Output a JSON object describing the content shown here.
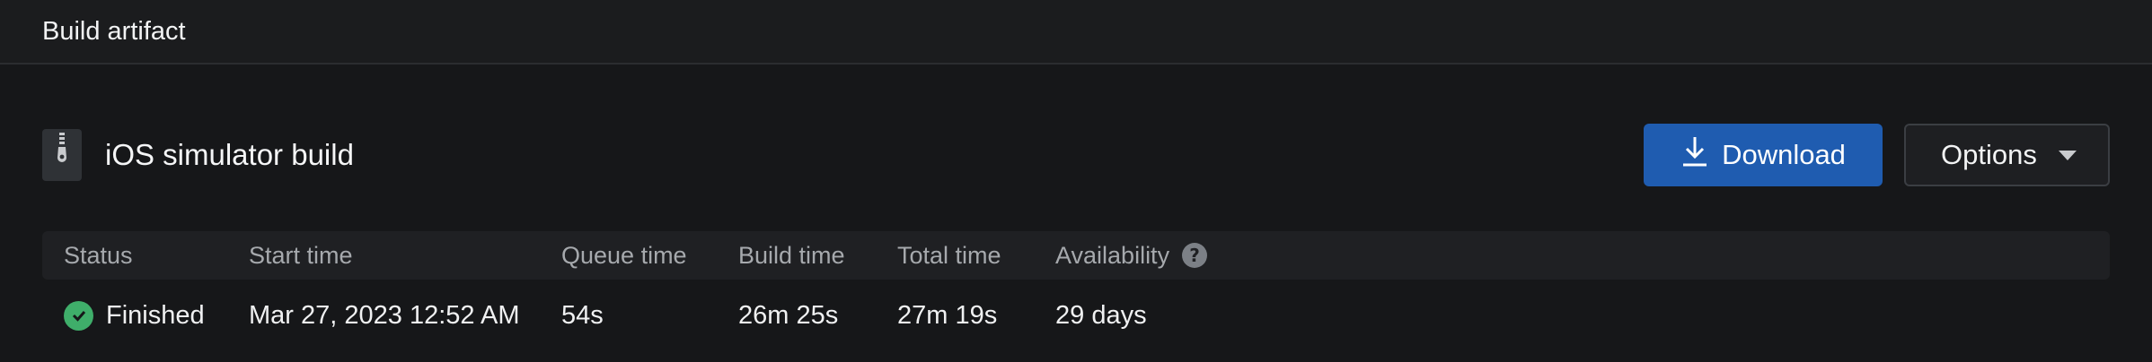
{
  "header": {
    "title": "Build artifact"
  },
  "artifact": {
    "icon": "zip-file-icon",
    "name": "iOS simulator build"
  },
  "actions": {
    "download_label": "Download",
    "download_icon": "download-icon",
    "options_label": "Options",
    "options_icon": "chevron-down-icon"
  },
  "table": {
    "columns": [
      "Status",
      "Start time",
      "Queue time",
      "Build time",
      "Total time",
      "Availability"
    ],
    "availability_help_icon": "help-icon",
    "row": {
      "status": "Finished",
      "status_icon": "check-circle-icon",
      "start_time": "Mar 27, 2023 12:52 AM",
      "queue_time": "54s",
      "build_time": "26m 25s",
      "total_time": "27m 19s",
      "availability": "29 days"
    }
  },
  "colors": {
    "background": "#161719",
    "primary_button": "#1f5cb0",
    "success": "#3fae6a"
  }
}
